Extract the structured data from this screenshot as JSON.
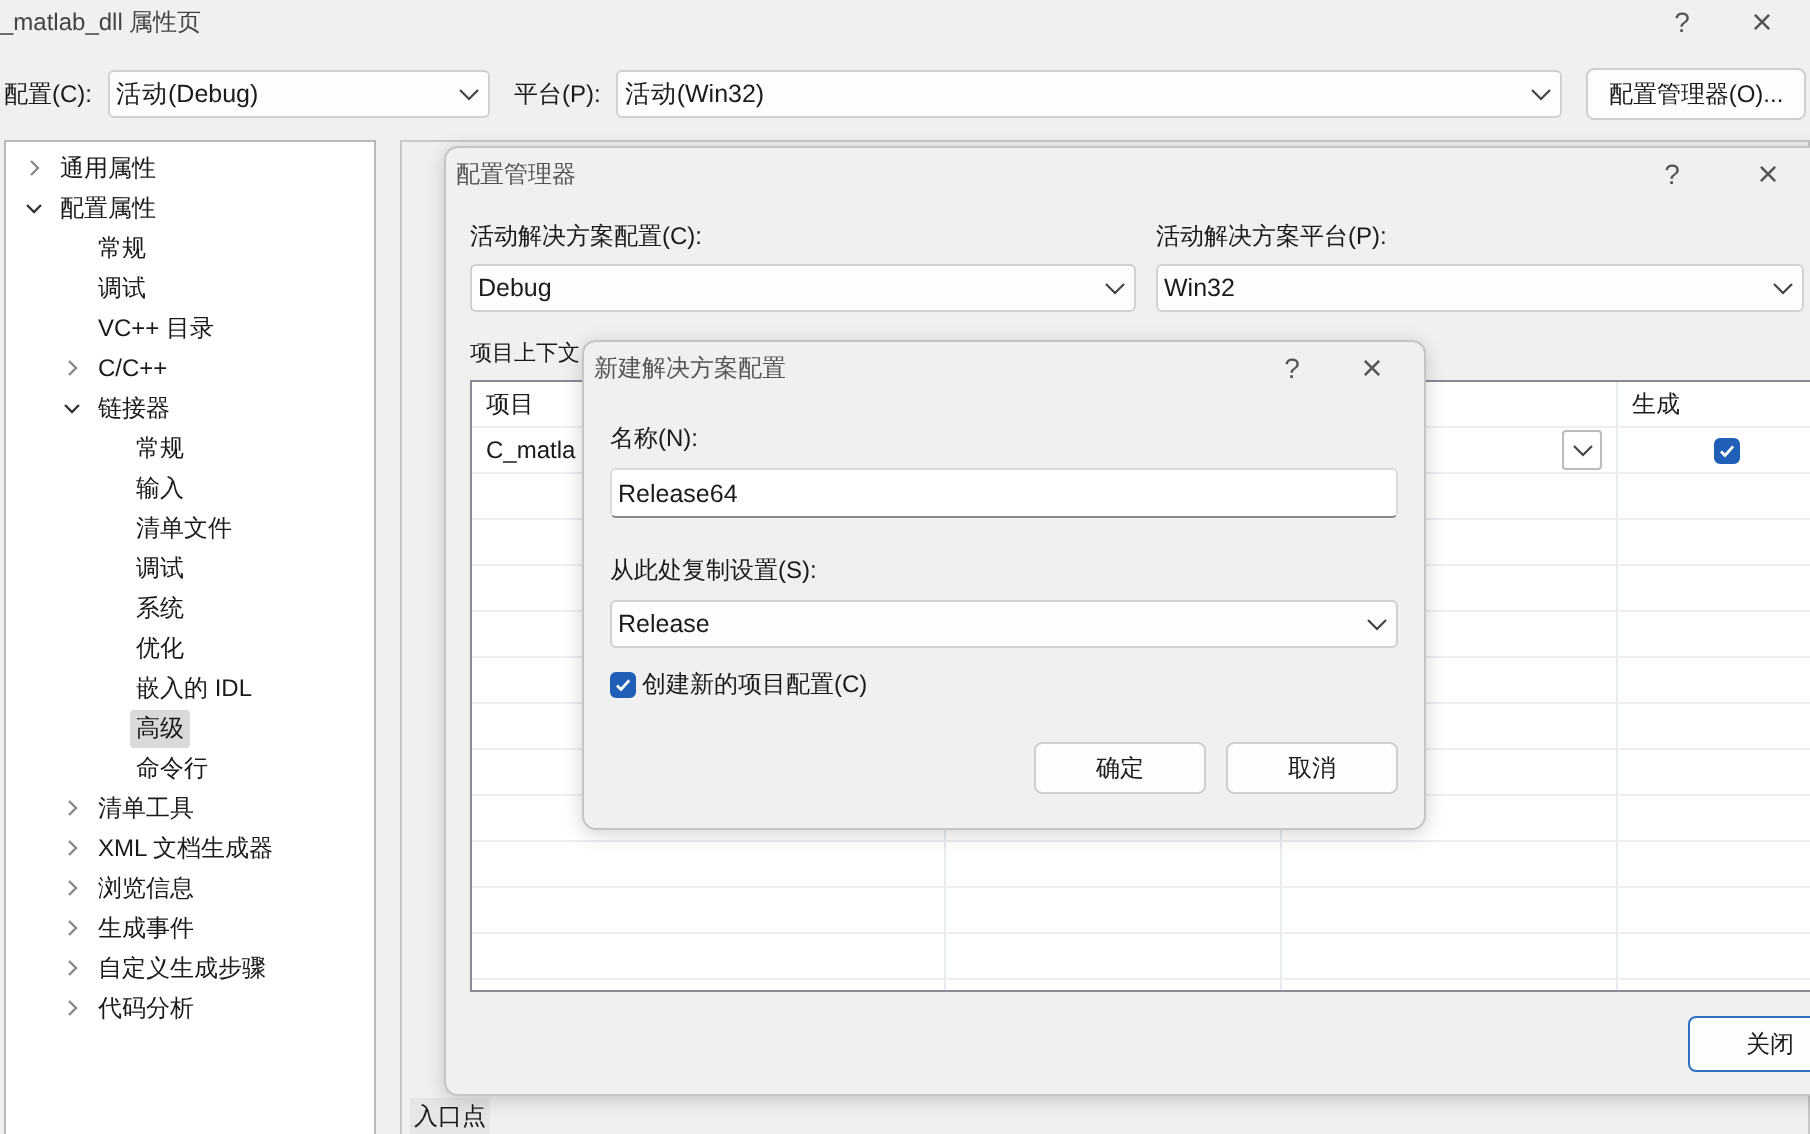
{
  "window": {
    "title": "_matlab_dll 属性页",
    "help": "?",
    "close": "×"
  },
  "config_bar": {
    "config_label": "配置(C):",
    "config_value": "活动(Debug)",
    "platform_label": "平台(P):",
    "platform_value": "活动(Win32)",
    "manager_button": "配置管理器(O)..."
  },
  "tree": [
    {
      "label": "通用属性",
      "expanded": false,
      "selected": false
    },
    {
      "label": "配置属性",
      "expanded": true,
      "selected": false,
      "children": [
        {
          "label": "常规",
          "selected": false
        },
        {
          "label": "调试",
          "selected": false
        },
        {
          "label": "VC++ 目录",
          "selected": false
        },
        {
          "label": "C/C++",
          "expanded": false,
          "selected": false
        },
        {
          "label": "链接器",
          "expanded": true,
          "selected": false,
          "children": [
            {
              "label": "常规",
              "selected": false
            },
            {
              "label": "输入",
              "selected": false
            },
            {
              "label": "清单文件",
              "selected": false
            },
            {
              "label": "调试",
              "selected": false
            },
            {
              "label": "系统",
              "selected": false
            },
            {
              "label": "优化",
              "selected": false
            },
            {
              "label": "嵌入的 IDL",
              "selected": false
            },
            {
              "label": "高级",
              "selected": true
            },
            {
              "label": "命令行",
              "selected": false
            }
          ]
        },
        {
          "label": "清单工具",
          "expanded": false,
          "selected": false
        },
        {
          "label": "XML 文档生成器",
          "expanded": false,
          "selected": false
        },
        {
          "label": "浏览信息",
          "expanded": false,
          "selected": false
        },
        {
          "label": "生成事件",
          "expanded": false,
          "selected": false
        },
        {
          "label": "自定义生成步骤",
          "expanded": false,
          "selected": false
        },
        {
          "label": "代码分析",
          "expanded": false,
          "selected": false
        }
      ]
    }
  ],
  "bottom_label": "入口点",
  "config_manager": {
    "title": "配置管理器",
    "help": "?",
    "close": "×",
    "solution_config_label": "活动解决方案配置(C):",
    "solution_config_value": "Debug",
    "solution_platform_label": "活动解决方案平台(P):",
    "solution_platform_value": "Win32",
    "contexts_label": "项目上下文",
    "grid": {
      "column_1": "项目",
      "column_4": "生成",
      "rows": [
        {
          "project": "C_matla",
          "build": true
        }
      ]
    },
    "close_button": "关闭"
  },
  "new_config_dialog": {
    "title": "新建解决方案配置",
    "help": "?",
    "close": "×",
    "name_label": "名称(N):",
    "name_value": "Release64",
    "copy_label": "从此处复制设置(S):",
    "copy_value": "Release",
    "create_project_configs": {
      "label": "创建新的项目配置(C)",
      "checked": true
    },
    "ok_button": "确定",
    "cancel_button": "取消"
  }
}
